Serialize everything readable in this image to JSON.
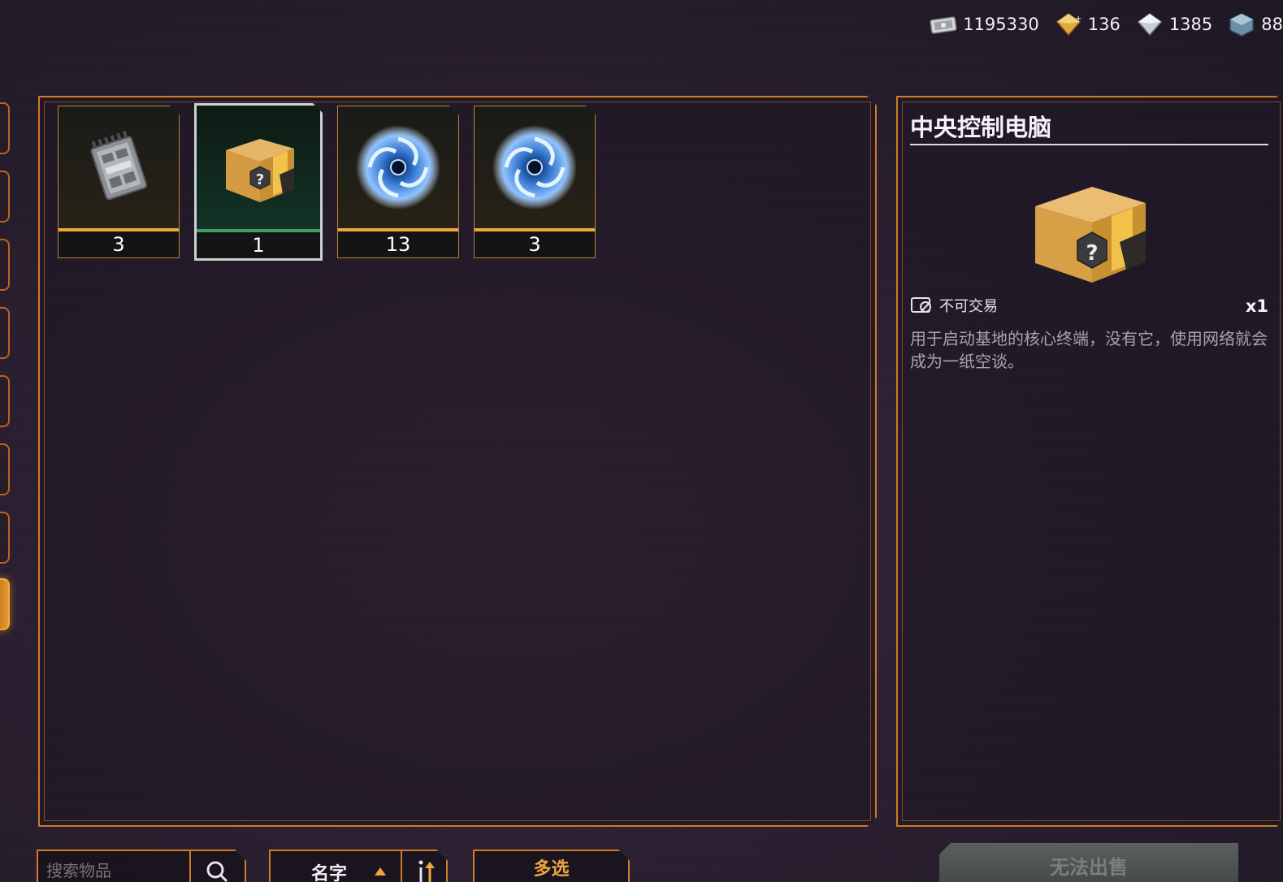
{
  "currencies": [
    {
      "name": "cash-ticket-icon",
      "value": "1195330"
    },
    {
      "name": "gold-crystal-icon",
      "value": "136"
    },
    {
      "name": "silver-crystal-icon",
      "value": "1385"
    },
    {
      "name": "blue-cube-icon",
      "value": "88"
    }
  ],
  "inventory": {
    "items": [
      {
        "name": "circuit-chip",
        "count": "3",
        "selected": false
      },
      {
        "name": "mystery-box",
        "count": "1",
        "selected": true
      },
      {
        "name": "blue-vortex-orb",
        "count": "13",
        "selected": false
      },
      {
        "name": "blue-vortex-orb",
        "count": "3",
        "selected": false
      }
    ]
  },
  "detail": {
    "title": "中央控制电脑",
    "tradable_label": "不可交易",
    "quantity": "x1",
    "description": "用于启动基地的核心终端，没有它，使用网络就会成为一纸空谈。"
  },
  "controls": {
    "search_placeholder": "搜索物品",
    "sort_label": "名字",
    "multi_select_label": "多选",
    "sell_label": "无法出售"
  },
  "colors": {
    "accent_orange": "#cf7a26",
    "count_bar": "#f0a53c",
    "selected_bar": "#3fa066"
  }
}
